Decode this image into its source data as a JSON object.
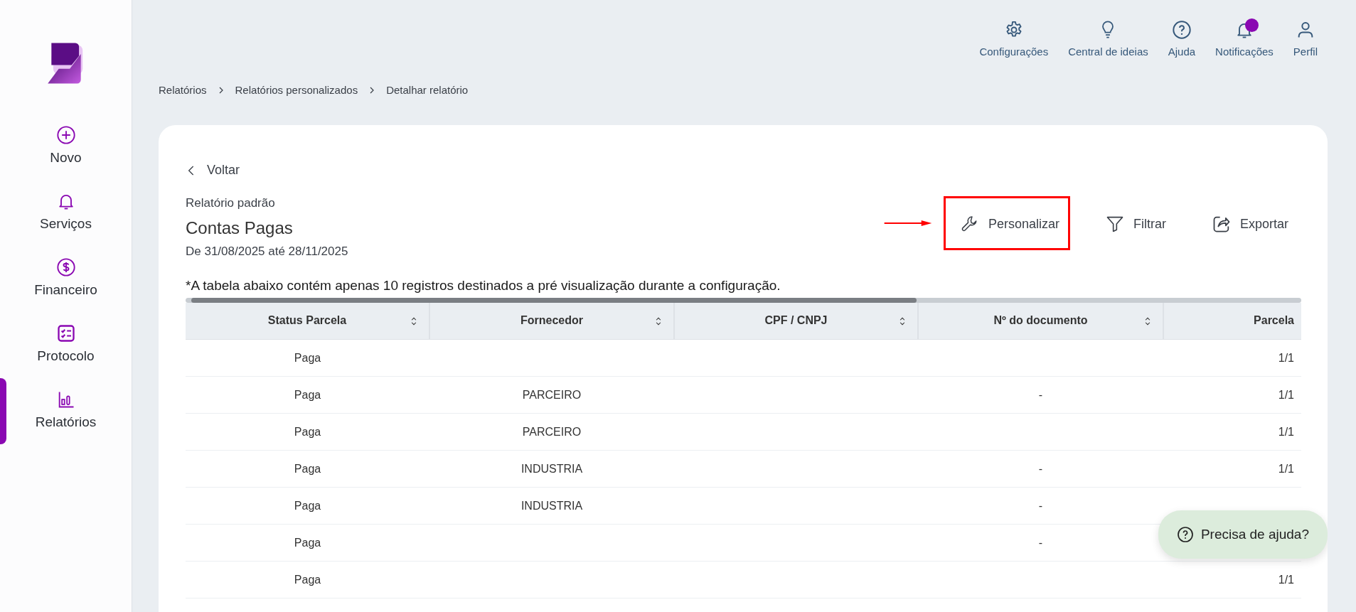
{
  "sidebar": {
    "items": [
      {
        "label": "Novo",
        "selected": false
      },
      {
        "label": "Serviços",
        "selected": false
      },
      {
        "label": "Financeiro",
        "selected": false
      },
      {
        "label": "Protocolo",
        "selected": false
      },
      {
        "label": "Relatórios",
        "selected": true
      }
    ]
  },
  "top_nav": [
    {
      "label": "Configurações",
      "badge": false
    },
    {
      "label": "Central de ideias",
      "badge": false
    },
    {
      "label": "Ajuda",
      "badge": false
    },
    {
      "label": "Notificações",
      "badge": true
    },
    {
      "label": "Perfil",
      "badge": false
    }
  ],
  "breadcrumb": [
    "Relatórios",
    "Relatórios personalizados",
    "Detalhar relatório"
  ],
  "back_link": "Voltar",
  "report": {
    "subtitle": "Relatório padrão",
    "title": "Contas Pagas",
    "period": "De 31/08/2025 até 28/11/2025"
  },
  "actions": [
    {
      "label": "Personalizar",
      "highlighted": true
    },
    {
      "label": "Filtrar",
      "highlighted": false
    },
    {
      "label": "Exportar",
      "highlighted": false
    }
  ],
  "notice": "*A tabela abaixo contém apenas 10 registros destinados a pré visualização durante a configuração.",
  "table": {
    "columns": [
      {
        "label": "Status Parcela",
        "sortable": true
      },
      {
        "label": "Fornecedor",
        "sortable": true
      },
      {
        "label": "CPF / CNPJ",
        "sortable": true
      },
      {
        "label": "Nº do documento",
        "sortable": true
      },
      {
        "label": "Parcela",
        "sortable": false
      }
    ],
    "rows": [
      [
        "Paga",
        "",
        "",
        "",
        "1/1"
      ],
      [
        "Paga",
        "PARCEIRO",
        "",
        "-",
        "1/1"
      ],
      [
        "Paga",
        "PARCEIRO",
        "",
        "",
        "1/1"
      ],
      [
        "Paga",
        "INDUSTRIA",
        "",
        "-",
        "1/1"
      ],
      [
        "Paga",
        "INDUSTRIA",
        "",
        "-",
        ""
      ],
      [
        "Paga",
        "",
        "",
        "-",
        ""
      ],
      [
        "Paga",
        "",
        "",
        "",
        "1/1"
      ]
    ]
  },
  "help_button": "Precisa de ajuda?"
}
